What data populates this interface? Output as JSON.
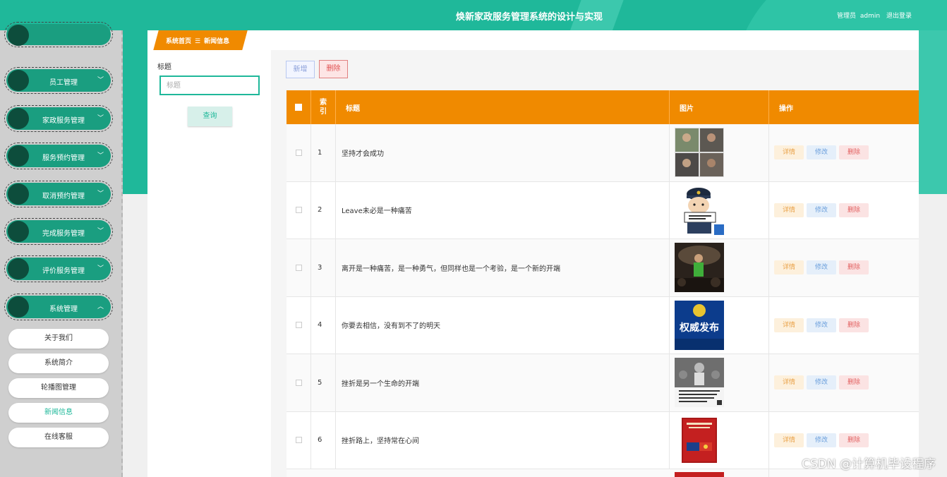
{
  "header": {
    "title": "焕新家政服务管理系统的设计与实现",
    "role": "管理员",
    "username": "admin",
    "logout": "退出登录"
  },
  "sidebar": {
    "menus": [
      {
        "label": "员工管理",
        "chevron": "﹀"
      },
      {
        "label": "家政服务管理",
        "chevron": "﹀"
      },
      {
        "label": "服务预约管理",
        "chevron": "﹀"
      },
      {
        "label": "取消预约管理",
        "chevron": "﹀"
      },
      {
        "label": "完成服务管理",
        "chevron": "﹀"
      },
      {
        "label": "评价服务管理",
        "chevron": "﹀"
      },
      {
        "label": "系统管理",
        "chevron": "︿"
      }
    ],
    "submenu": [
      {
        "label": "关于我们"
      },
      {
        "label": "系统简介"
      },
      {
        "label": "轮播图管理"
      },
      {
        "label": "新闻信息",
        "active": true
      },
      {
        "label": "在线客服"
      }
    ]
  },
  "breadcrumb": {
    "home": "系统首页",
    "separator": "☰",
    "current": "新闻信息"
  },
  "search": {
    "label": "标题",
    "placeholder": "标题",
    "value": "",
    "button": "查询"
  },
  "toolbar": {
    "add": "新增",
    "delete": "删除"
  },
  "table": {
    "columns": {
      "index": "索引",
      "title": "标题",
      "image": "图片",
      "ops": "操作"
    },
    "ops": {
      "detail": "详情",
      "edit": "修改",
      "delete": "删除"
    },
    "rows": [
      {
        "index": "1",
        "title": "坚持才会成功",
        "image": "photo-collage"
      },
      {
        "index": "2",
        "title": "Leave未必是一种痛苦",
        "image": "police-cartoon"
      },
      {
        "index": "3",
        "title": "离开是一种痛苦，是一种勇气，但同样也是一个考验，是一个新的开端",
        "image": "concert-photo"
      },
      {
        "index": "4",
        "title": "你要去相信，没有到不了的明天",
        "image": "authority-release",
        "image_text": "权威发布"
      },
      {
        "index": "5",
        "title": "挫折是另一个生命的开端",
        "image": "crowd-photo"
      },
      {
        "index": "6",
        "title": "挫折路上，坚持常在心间",
        "image": "book-cover"
      }
    ]
  },
  "colors": {
    "primary": "#1fb89a",
    "header_orange": "#f08a00",
    "sidebar_menu": "#1a9e80"
  },
  "watermark": "CSDN @计算机毕设程序"
}
